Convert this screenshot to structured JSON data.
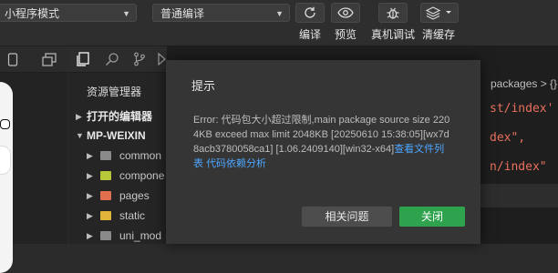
{
  "toolbar": {
    "mode_value": "小程序模式",
    "compile_value": "普通编译",
    "buttons": [
      {
        "icon": "refresh-icon",
        "label": "编译"
      },
      {
        "icon": "eye-icon",
        "label": "预览"
      },
      {
        "icon": "bug-icon",
        "label": "真机调试"
      },
      {
        "icon": "layers-icon",
        "label": "清缓存"
      }
    ]
  },
  "explorer": {
    "title": "资源管理器",
    "open_editors": "打开的编辑器",
    "project": "MP-WEIXIN",
    "folders": [
      "common",
      "compone",
      "pages",
      "static",
      "uni_mod"
    ]
  },
  "editor": {
    "breadcrumb": "packages > {}",
    "code_lines": [
      "st/index'",
      "dex\",",
      "n/index\""
    ]
  },
  "dialog": {
    "title": "提示",
    "message": "Error: 代码包大小超过限制,main package source size 2204KB exceed max limit 2048KB [20250610 15:38:05][wx7d8acb3780058ca1] [1.06.2409140][win32-x64]",
    "link_view_files": "查看文件列表",
    "link_dependency": "代码依赖分析",
    "related_button": "相关问题",
    "close_button": "关闭"
  },
  "colors": {
    "accent_green": "#2fa24e",
    "link_blue": "#4ea6ff",
    "code_red": "#e8705e"
  }
}
